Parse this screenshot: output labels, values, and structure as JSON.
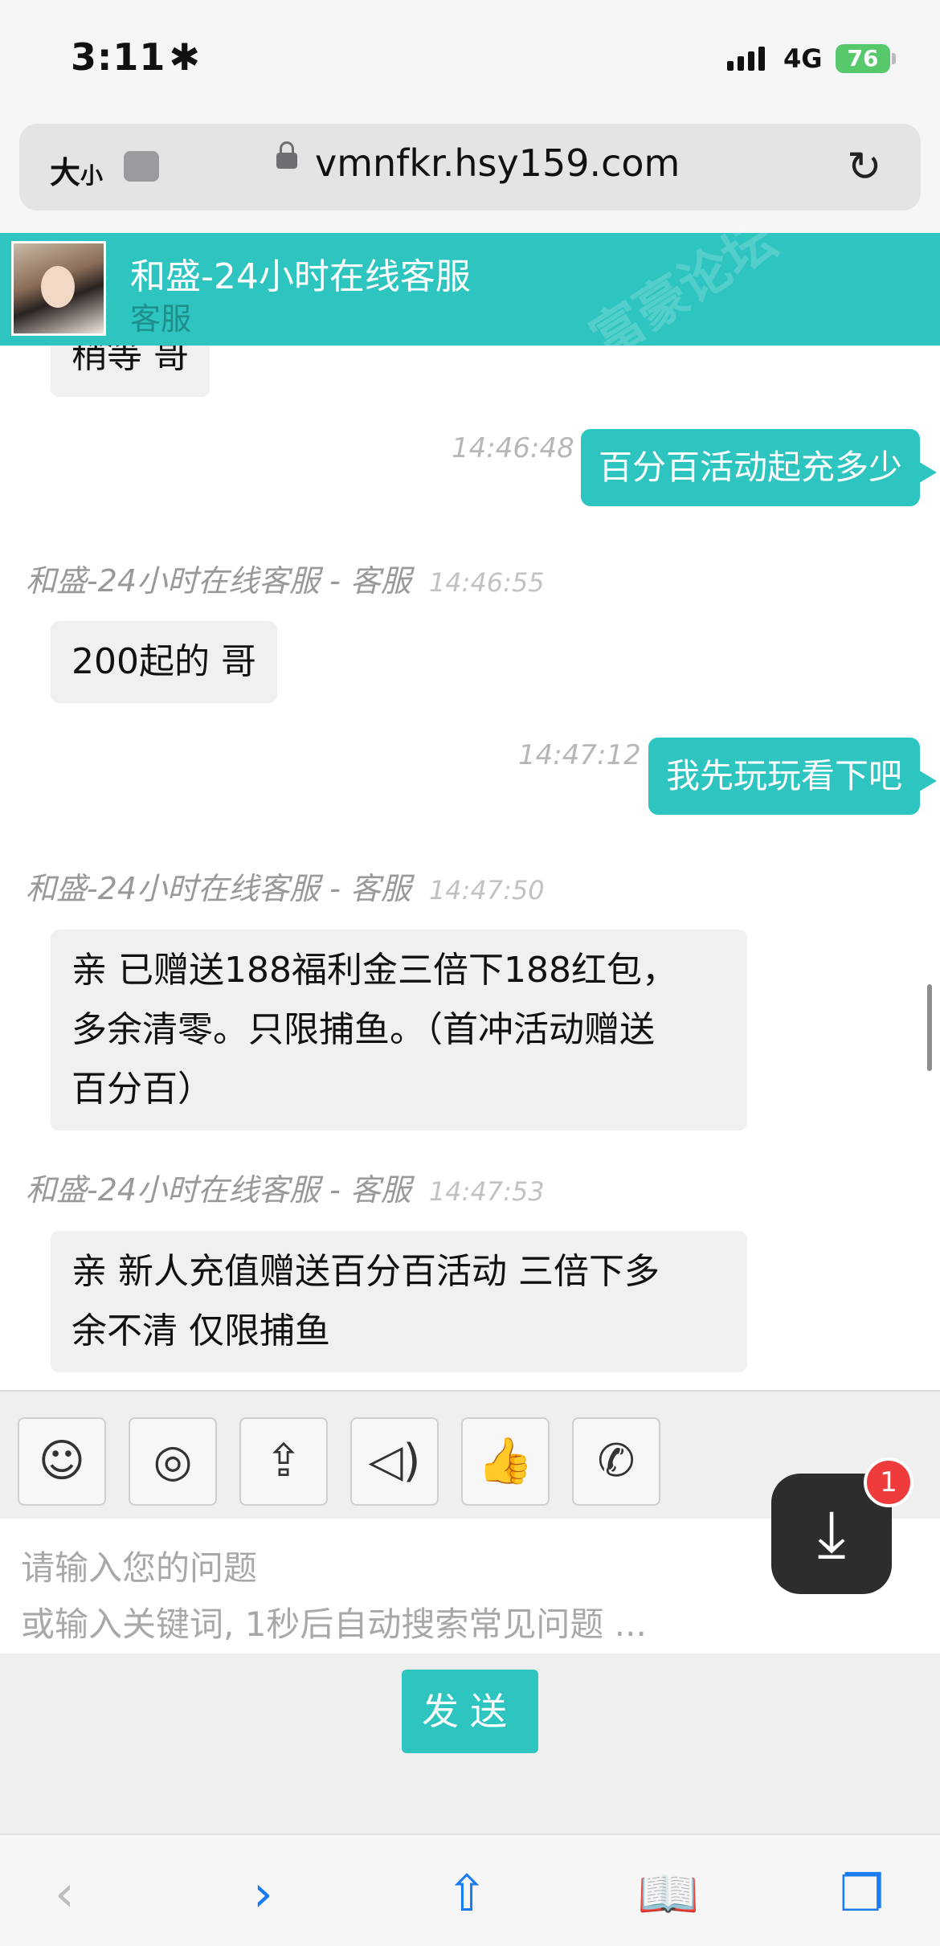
{
  "status": {
    "time": "3:11",
    "network": "4G",
    "battery": "76"
  },
  "browser": {
    "aa": "大",
    "aa_small": "小",
    "url": "vmnfkr.hsy159.com"
  },
  "chat": {
    "name": "和盛-24小时在线客服",
    "role": "客服",
    "partial_text": "稍等 哥",
    "messages": [
      {
        "side": "right",
        "time": "14:46:48",
        "text": "百分百活动起充多少"
      },
      {
        "side": "left",
        "meta": "和盛-24小时在线客服 - 客服",
        "time": "14:46:55",
        "text": "200起的 哥"
      },
      {
        "side": "right",
        "time": "14:47:12",
        "text": "我先玩玩看下吧"
      },
      {
        "side": "left",
        "meta": "和盛-24小时在线客服 - 客服",
        "time": "14:47:50",
        "lines": [
          "亲 已赠送188福利金三倍下188红包，",
          "多余清零。只限捕鱼。（首冲活动赠送",
          "百分百）"
        ]
      },
      {
        "side": "left",
        "meta": "和盛-24小时在线客服 - 客服",
        "time": "14:47:53",
        "lines": [
          "亲 新人充值赠送百分百活动 三倍下多",
          "余不清 仅限捕鱼"
        ]
      }
    ]
  },
  "toolbar": {
    "icons": [
      "emoji-icon",
      "camera-icon",
      "upload-icon",
      "voice-icon",
      "thumbs-up-icon",
      "phone-icon"
    ]
  },
  "input": {
    "placeholder_line1": "请输入您的问题",
    "placeholder_line2": "或输入关键词, 1秒后自动搜索常见问题 ..."
  },
  "download": {
    "badge": "1"
  },
  "send": {
    "label": "发送"
  },
  "watermark": "富豪论坛"
}
